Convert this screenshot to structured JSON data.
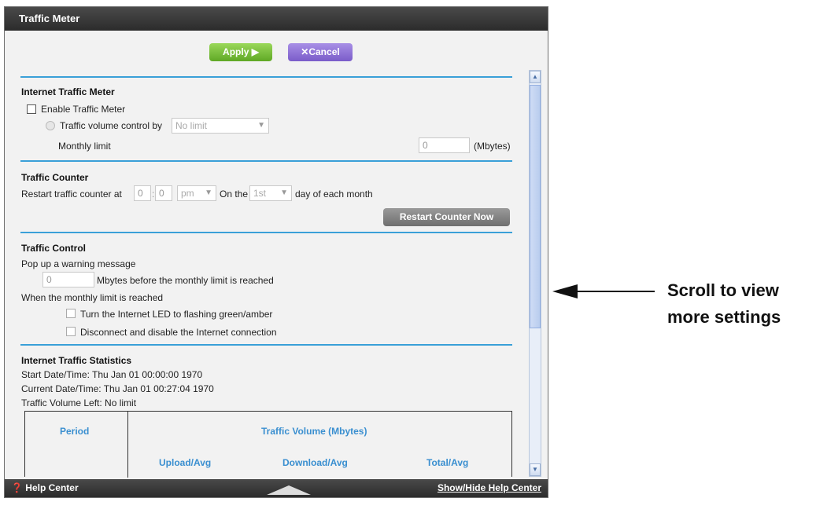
{
  "window": {
    "title": "Traffic Meter"
  },
  "toolbar": {
    "apply_label": "Apply ▶",
    "cancel_label": "Cancel",
    "cancel_icon": "✕"
  },
  "internet_traffic_meter": {
    "heading": "Internet Traffic Meter",
    "enable_label": "Enable Traffic Meter",
    "volume_control_label": "Traffic volume control by",
    "volume_control_value": "No limit",
    "monthly_limit_label": "Monthly limit",
    "monthly_limit_value": "0",
    "monthly_limit_unit": "(Mbytes)"
  },
  "traffic_counter": {
    "heading": "Traffic Counter",
    "restart_label": "Restart traffic counter at",
    "hour": "0",
    "minute": "0",
    "ampm": "pm",
    "on_the_label": "On the",
    "day_value": "1st",
    "day_suffix": "day of each month",
    "restart_button": "Restart Counter Now"
  },
  "traffic_control": {
    "heading": "Traffic Control",
    "popup_label": "Pop up a warning message",
    "mbytes_value": "0",
    "mbytes_label": "Mbytes before the monthly limit is reached",
    "when_label": "When the monthly limit is reached",
    "led_label": "Turn the Internet LED to flashing green/amber",
    "disconnect_label": "Disconnect and disable the Internet connection"
  },
  "statistics": {
    "heading": "Internet Traffic Statistics",
    "start": "Start Date/Time: Thu Jan 01 00:00:00 1970",
    "current": "Current Date/Time: Thu Jan 01 00:27:04 1970",
    "left": "Traffic Volume Left: No limit",
    "table": {
      "period": "Period",
      "volume": "Traffic Volume (Mbytes)",
      "upload": "Upload/Avg",
      "download": "Download/Avg",
      "total": "Total/Avg"
    }
  },
  "footer": {
    "help_center": "Help Center",
    "show_hide": "Show/Hide Help Center"
  },
  "annotation": {
    "line1": "Scroll to view",
    "line2": "more settings"
  },
  "colors": {
    "apply": "#6fba33",
    "cancel": "#8b6fd8",
    "divider": "#3aa0d8",
    "table_header": "#3a8fd0"
  }
}
